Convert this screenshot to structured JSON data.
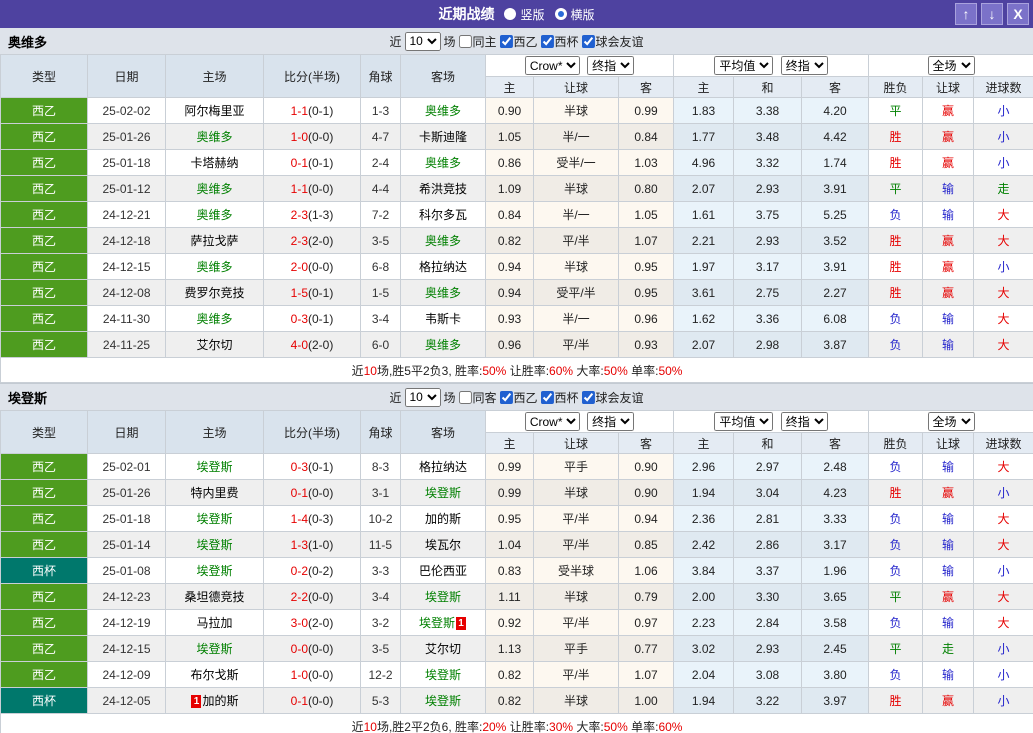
{
  "titlebar": {
    "title": "近期战绩",
    "radios": [
      {
        "label": "竖版",
        "selected": false
      },
      {
        "label": "横版",
        "selected": true
      }
    ],
    "buttons": [
      {
        "name": "scroll-up",
        "glyph": "↑"
      },
      {
        "name": "scroll-down",
        "glyph": "↓"
      },
      {
        "name": "close",
        "glyph": "X"
      }
    ]
  },
  "colors": {
    "titlebar": "#4e42a0",
    "titlebar_button": "#7b72c9",
    "liga_badge": "#4e9c1f",
    "cup_badge": "#00786c",
    "team_highlight": "#008000",
    "score_red": "#e60000",
    "result_red": "#e60000",
    "result_blue": "#2525cc",
    "result_green": "#008000"
  },
  "sections": [
    {
      "team": "奥维多",
      "filter": {
        "near": "近",
        "count": "10",
        "games": "场",
        "same": "同主",
        "same_checked": false,
        "leagues": [
          "西乙",
          "西杯",
          "球会友谊"
        ]
      },
      "header": {
        "cols": [
          "类型",
          "日期",
          "主场",
          "比分(半场)",
          "角球",
          "客场"
        ],
        "company": "Crow*",
        "company_time": "终指",
        "avg": "平均值",
        "avg_time": "终指",
        "scope": "全场",
        "odds_cols": [
          "主",
          "让球",
          "客"
        ],
        "avg_cols": [
          "主",
          "和",
          "客"
        ],
        "res_cols": [
          "胜负",
          "让球",
          "进球数"
        ]
      },
      "rows": [
        {
          "type": "西乙",
          "cup": false,
          "date": "25-02-02",
          "home": "阿尔梅里亚",
          "home_hl": false,
          "ft": "1-1",
          "ht": "(0-1)",
          "corner": "1-3",
          "away": "奥维多",
          "away_hl": true,
          "odds": [
            "0.90",
            "半球",
            "0.99"
          ],
          "avg": [
            "1.83",
            "3.38",
            "4.20"
          ],
          "res": [
            "平",
            "赢",
            "小"
          ],
          "res_c": [
            "green",
            "red",
            "blue"
          ]
        },
        {
          "type": "西乙",
          "cup": false,
          "date": "25-01-26",
          "home": "奥维多",
          "home_hl": true,
          "ft": "1-0",
          "ht": "(0-0)",
          "corner": "4-7",
          "away": "卡斯迪隆",
          "away_hl": false,
          "odds": [
            "1.05",
            "半/一",
            "0.84"
          ],
          "avg": [
            "1.77",
            "3.48",
            "4.42"
          ],
          "res": [
            "胜",
            "赢",
            "小"
          ],
          "res_c": [
            "red",
            "red",
            "blue"
          ]
        },
        {
          "type": "西乙",
          "cup": false,
          "date": "25-01-18",
          "home": "卡塔赫纳",
          "home_hl": false,
          "ft": "0-1",
          "ht": "(0-1)",
          "corner": "2-4",
          "away": "奥维多",
          "away_hl": true,
          "odds": [
            "0.86",
            "受半/一",
            "1.03"
          ],
          "avg": [
            "4.96",
            "3.32",
            "1.74"
          ],
          "res": [
            "胜",
            "赢",
            "小"
          ],
          "res_c": [
            "red",
            "red",
            "blue"
          ]
        },
        {
          "type": "西乙",
          "cup": false,
          "date": "25-01-12",
          "home": "奥维多",
          "home_hl": true,
          "ft": "1-1",
          "ht": "(0-0)",
          "corner": "4-4",
          "away": "希洪竞技",
          "away_hl": false,
          "odds": [
            "1.09",
            "半球",
            "0.80"
          ],
          "avg": [
            "2.07",
            "2.93",
            "3.91"
          ],
          "res": [
            "平",
            "输",
            "走"
          ],
          "res_c": [
            "green",
            "blue",
            "green"
          ]
        },
        {
          "type": "西乙",
          "cup": false,
          "date": "24-12-21",
          "home": "奥维多",
          "home_hl": true,
          "ft": "2-3",
          "ht": "(1-3)",
          "corner": "7-2",
          "away": "科尔多瓦",
          "away_hl": false,
          "odds": [
            "0.84",
            "半/一",
            "1.05"
          ],
          "avg": [
            "1.61",
            "3.75",
            "5.25"
          ],
          "res": [
            "负",
            "输",
            "大"
          ],
          "res_c": [
            "blue",
            "blue",
            "red"
          ]
        },
        {
          "type": "西乙",
          "cup": false,
          "date": "24-12-18",
          "home": "萨拉戈萨",
          "home_hl": false,
          "ft": "2-3",
          "ht": "(2-0)",
          "corner": "3-5",
          "away": "奥维多",
          "away_hl": true,
          "odds": [
            "0.82",
            "平/半",
            "1.07"
          ],
          "avg": [
            "2.21",
            "2.93",
            "3.52"
          ],
          "res": [
            "胜",
            "赢",
            "大"
          ],
          "res_c": [
            "red",
            "red",
            "red"
          ]
        },
        {
          "type": "西乙",
          "cup": false,
          "date": "24-12-15",
          "home": "奥维多",
          "home_hl": true,
          "ft": "2-0",
          "ht": "(0-0)",
          "corner": "6-8",
          "away": "格拉纳达",
          "away_hl": false,
          "odds": [
            "0.94",
            "半球",
            "0.95"
          ],
          "avg": [
            "1.97",
            "3.17",
            "3.91"
          ],
          "res": [
            "胜",
            "赢",
            "小"
          ],
          "res_c": [
            "red",
            "red",
            "blue"
          ]
        },
        {
          "type": "西乙",
          "cup": false,
          "date": "24-12-08",
          "home": "费罗尔竞技",
          "home_hl": false,
          "ft": "1-5",
          "ht": "(0-1)",
          "corner": "1-5",
          "away": "奥维多",
          "away_hl": true,
          "odds": [
            "0.94",
            "受平/半",
            "0.95"
          ],
          "avg": [
            "3.61",
            "2.75",
            "2.27"
          ],
          "res": [
            "胜",
            "赢",
            "大"
          ],
          "res_c": [
            "red",
            "red",
            "red"
          ]
        },
        {
          "type": "西乙",
          "cup": false,
          "date": "24-11-30",
          "home": "奥维多",
          "home_hl": true,
          "ft": "0-3",
          "ht": "(0-1)",
          "corner": "3-4",
          "away": "韦斯卡",
          "away_hl": false,
          "odds": [
            "0.93",
            "半/一",
            "0.96"
          ],
          "avg": [
            "1.62",
            "3.36",
            "6.08"
          ],
          "res": [
            "负",
            "输",
            "大"
          ],
          "res_c": [
            "blue",
            "blue",
            "red"
          ]
        },
        {
          "type": "西乙",
          "cup": false,
          "date": "24-11-25",
          "home": "艾尔切",
          "home_hl": false,
          "ft": "4-0",
          "ht": "(2-0)",
          "corner": "6-0",
          "away": "奥维多",
          "away_hl": true,
          "odds": [
            "0.96",
            "平/半",
            "0.93"
          ],
          "avg": [
            "2.07",
            "2.98",
            "3.87"
          ],
          "res": [
            "负",
            "输",
            "大"
          ],
          "res_c": [
            "blue",
            "blue",
            "red"
          ]
        }
      ],
      "summary": [
        {
          "t": "近"
        },
        {
          "t": "10",
          "red": true
        },
        {
          "t": "场,胜5平2负3, 胜率:"
        },
        {
          "t": "50%",
          "red": true
        },
        {
          "t": " 让胜率:"
        },
        {
          "t": "60%",
          "red": true
        },
        {
          "t": " 大率:"
        },
        {
          "t": "50%",
          "red": true
        },
        {
          "t": " 单率:"
        },
        {
          "t": "50%",
          "red": true
        }
      ]
    },
    {
      "team": "埃登斯",
      "filter": {
        "near": "近",
        "count": "10",
        "games": "场",
        "same": "同客",
        "same_checked": false,
        "leagues": [
          "西乙",
          "西杯",
          "球会友谊"
        ]
      },
      "header": {
        "cols": [
          "类型",
          "日期",
          "主场",
          "比分(半场)",
          "角球",
          "客场"
        ],
        "company": "Crow*",
        "company_time": "终指",
        "avg": "平均值",
        "avg_time": "终指",
        "scope": "全场",
        "odds_cols": [
          "主",
          "让球",
          "客"
        ],
        "avg_cols": [
          "主",
          "和",
          "客"
        ],
        "res_cols": [
          "胜负",
          "让球",
          "进球数"
        ]
      },
      "rows": [
        {
          "type": "西乙",
          "cup": false,
          "date": "25-02-01",
          "home": "埃登斯",
          "home_hl": true,
          "ft": "0-3",
          "ht": "(0-1)",
          "corner": "8-3",
          "away": "格拉纳达",
          "away_hl": false,
          "odds": [
            "0.99",
            "平手",
            "0.90"
          ],
          "avg": [
            "2.96",
            "2.97",
            "2.48"
          ],
          "res": [
            "负",
            "输",
            "大"
          ],
          "res_c": [
            "blue",
            "blue",
            "red"
          ]
        },
        {
          "type": "西乙",
          "cup": false,
          "date": "25-01-26",
          "home": "特内里费",
          "home_hl": false,
          "ft": "0-1",
          "ht": "(0-0)",
          "corner": "3-1",
          "away": "埃登斯",
          "away_hl": true,
          "odds": [
            "0.99",
            "半球",
            "0.90"
          ],
          "avg": [
            "1.94",
            "3.04",
            "4.23"
          ],
          "res": [
            "胜",
            "赢",
            "小"
          ],
          "res_c": [
            "red",
            "red",
            "blue"
          ]
        },
        {
          "type": "西乙",
          "cup": false,
          "date": "25-01-18",
          "home": "埃登斯",
          "home_hl": true,
          "ft": "1-4",
          "ht": "(0-3)",
          "corner": "10-2",
          "away": "加的斯",
          "away_hl": false,
          "odds": [
            "0.95",
            "平/半",
            "0.94"
          ],
          "avg": [
            "2.36",
            "2.81",
            "3.33"
          ],
          "res": [
            "负",
            "输",
            "大"
          ],
          "res_c": [
            "blue",
            "blue",
            "red"
          ]
        },
        {
          "type": "西乙",
          "cup": false,
          "date": "25-01-14",
          "home": "埃登斯",
          "home_hl": true,
          "ft": "1-3",
          "ht": "(1-0)",
          "corner": "11-5",
          "away": "埃瓦尔",
          "away_hl": false,
          "odds": [
            "1.04",
            "平/半",
            "0.85"
          ],
          "avg": [
            "2.42",
            "2.86",
            "3.17"
          ],
          "res": [
            "负",
            "输",
            "大"
          ],
          "res_c": [
            "blue",
            "blue",
            "red"
          ]
        },
        {
          "type": "西杯",
          "cup": true,
          "date": "25-01-08",
          "home": "埃登斯",
          "home_hl": true,
          "ft": "0-2",
          "ht": "(0-2)",
          "corner": "3-3",
          "away": "巴伦西亚",
          "away_hl": false,
          "odds": [
            "0.83",
            "受半球",
            "1.06"
          ],
          "avg": [
            "3.84",
            "3.37",
            "1.96"
          ],
          "res": [
            "负",
            "输",
            "小"
          ],
          "res_c": [
            "blue",
            "blue",
            "blue"
          ]
        },
        {
          "type": "西乙",
          "cup": false,
          "date": "24-12-23",
          "home": "桑坦德竞技",
          "home_hl": false,
          "ft": "2-2",
          "ht": "(0-0)",
          "corner": "3-4",
          "away": "埃登斯",
          "away_hl": true,
          "odds": [
            "1.11",
            "半球",
            "0.79"
          ],
          "avg": [
            "2.00",
            "3.30",
            "3.65"
          ],
          "res": [
            "平",
            "赢",
            "大"
          ],
          "res_c": [
            "green",
            "red",
            "red"
          ]
        },
        {
          "type": "西乙",
          "cup": false,
          "date": "24-12-19",
          "home": "马拉加",
          "home_hl": false,
          "ft": "3-0",
          "ht": "(2-0)",
          "corner": "3-2",
          "away": "埃登斯",
          "away_hl": true,
          "away_card": "1",
          "away_card_pos": "after",
          "odds": [
            "0.92",
            "平/半",
            "0.97"
          ],
          "avg": [
            "2.23",
            "2.84",
            "3.58"
          ],
          "res": [
            "负",
            "输",
            "大"
          ],
          "res_c": [
            "blue",
            "blue",
            "red"
          ]
        },
        {
          "type": "西乙",
          "cup": false,
          "date": "24-12-15",
          "home": "埃登斯",
          "home_hl": true,
          "ft": "0-0",
          "ht": "(0-0)",
          "corner": "3-5",
          "away": "艾尔切",
          "away_hl": false,
          "odds": [
            "1.13",
            "平手",
            "0.77"
          ],
          "avg": [
            "3.02",
            "2.93",
            "2.45"
          ],
          "res": [
            "平",
            "走",
            "小"
          ],
          "res_c": [
            "green",
            "green",
            "blue"
          ]
        },
        {
          "type": "西乙",
          "cup": false,
          "date": "24-12-09",
          "home": "布尔戈斯",
          "home_hl": false,
          "ft": "1-0",
          "ht": "(0-0)",
          "corner": "12-2",
          "away": "埃登斯",
          "away_hl": true,
          "odds": [
            "0.82",
            "平/半",
            "1.07"
          ],
          "avg": [
            "2.04",
            "3.08",
            "3.80"
          ],
          "res": [
            "负",
            "输",
            "小"
          ],
          "res_c": [
            "blue",
            "blue",
            "blue"
          ]
        },
        {
          "type": "西杯",
          "cup": true,
          "date": "24-12-05",
          "home": "加的斯",
          "home_hl": false,
          "home_card": "1",
          "home_card_pos": "before",
          "ft": "0-1",
          "ht": "(0-0)",
          "corner": "5-3",
          "away": "埃登斯",
          "away_hl": true,
          "odds": [
            "0.82",
            "半球",
            "1.00"
          ],
          "avg": [
            "1.94",
            "3.22",
            "3.97"
          ],
          "res": [
            "胜",
            "赢",
            "小"
          ],
          "res_c": [
            "red",
            "red",
            "blue"
          ]
        }
      ],
      "summary": [
        {
          "t": "近"
        },
        {
          "t": "10",
          "red": true
        },
        {
          "t": "场,胜2平2负6, 胜率:"
        },
        {
          "t": "20%",
          "red": true
        },
        {
          "t": " 让胜率:"
        },
        {
          "t": "30%",
          "red": true
        },
        {
          "t": " 大率:"
        },
        {
          "t": "50%",
          "red": true
        },
        {
          "t": " 单率:"
        },
        {
          "t": "60%",
          "red": true
        }
      ]
    }
  ]
}
